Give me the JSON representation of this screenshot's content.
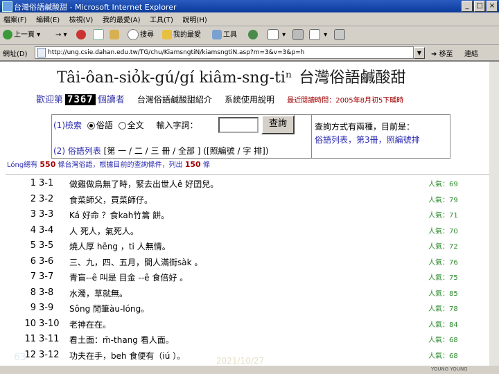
{
  "window": {
    "title": "台灣俗語鹹酸甜 - Microsoft Internet Explorer",
    "controls": [
      "_",
      "□",
      "×"
    ]
  },
  "menu": [
    "檔案(F)",
    "編輯(E)",
    "檢視(V)",
    "我的最愛(A)",
    "工具(T)",
    "說明(H)"
  ],
  "toolbar": {
    "back": "上一頁",
    "search": "搜尋",
    "favorites": "我的最愛",
    "tools": "工具"
  },
  "address": {
    "label": "網址(D)",
    "url": "http://ung.csie.dahan.edu.tw/TG/chu/KiamsngtiN/kiamsngtiN.asp?m=3&v=3&p=h",
    "go": "移至",
    "links": "連結"
  },
  "page": {
    "title_roman": "Tâi-ôan-siỏk-gú/gí kiâm-sng-tiⁿ",
    "title_cn": "台灣俗語鹹酸甜",
    "welcome_prefix": "歡迎第",
    "visitor_count": "7367",
    "welcome_suffix": "個讀者",
    "intro_link": "台灣俗語鹹酸甜紹介",
    "usage_link": "系統使用說明",
    "latest": "最近閱讀時間：2005年8月初5下晡時"
  },
  "search": {
    "label": "(1)檢索",
    "option1": "俗語",
    "option2": "全文",
    "input_label": "輸入字詞：",
    "button": "查詢",
    "list_label": "(2) 俗語列表",
    "list_options": "[第 一 / 二 / 三 冊 / 全部 ]",
    "sort_options": "([照編號 / 字 排])",
    "hint_line1": "查詢方式有兩種，目前是：",
    "hint_line2": "俗語列表，第3冊，照編號排"
  },
  "summary": {
    "prefix": "Lóng總有",
    "total": "550",
    "middle": "條台灣俗語，根據目前的查詢條件，列出",
    "listed": "150",
    "suffix": "條"
  },
  "items": [
    {
      "idx": "1",
      "code": "3-1",
      "text": "做雞做鳥無了時，緊去出世人ê 好囝兒。",
      "pop": "人氣：69"
    },
    {
      "idx": "2",
      "code": "3-2",
      "text": "食菜師父，買菜師仔。",
      "pop": "人氣：79"
    },
    {
      "idx": "3",
      "code": "3-3",
      "text": "Ká 好命 ？食kah竹篙 餅。",
      "pop": "人氣：71"
    },
    {
      "idx": "4",
      "code": "3-4",
      "text": "人 死人，氣死人。",
      "pop": "人氣：70"
    },
    {
      "idx": "5",
      "code": "3-5",
      "text": "燒人厚 hēng ，ti 人無情。",
      "pop": "人氣：72"
    },
    {
      "idx": "6",
      "code": "3-6",
      "text": "三、九，四、五月，間人滿街sàk 。",
      "pop": "人氣：76"
    },
    {
      "idx": "7",
      "code": "3-7",
      "text": "青盲--ê 叫是 目金 --ê 食倍好 。",
      "pop": "人氣：75"
    },
    {
      "idx": "8",
      "code": "3-8",
      "text": "水濁，草就無。",
      "pop": "人氣：85"
    },
    {
      "idx": "9",
      "code": "3-9",
      "text": "Sông 閒筆àu-lóng。",
      "pop": "人氣：78"
    },
    {
      "idx": "10",
      "code": "3-10",
      "text": "老神在在。",
      "pop": "人氣：84"
    },
    {
      "idx": "11",
      "code": "3-11",
      "text": "看土面：m̄-thang 看人面。",
      "pop": "人氣：68"
    },
    {
      "idx": "12",
      "code": "3-12",
      "text": "功夫在手，beh 食便有（iú ）。",
      "pop": "人氣：68"
    }
  ],
  "footer": {
    "slide_num": "63",
    "date": "2021/10/27",
    "watermark": "YOUNG YOUNG"
  },
  "colors": {
    "titlebar": "#0a3a9a",
    "chrome": "#d4d0c8",
    "link_blue": "#2a2ab0",
    "accent_red": "#a00000",
    "popularity_green": "#2a8a2a"
  }
}
